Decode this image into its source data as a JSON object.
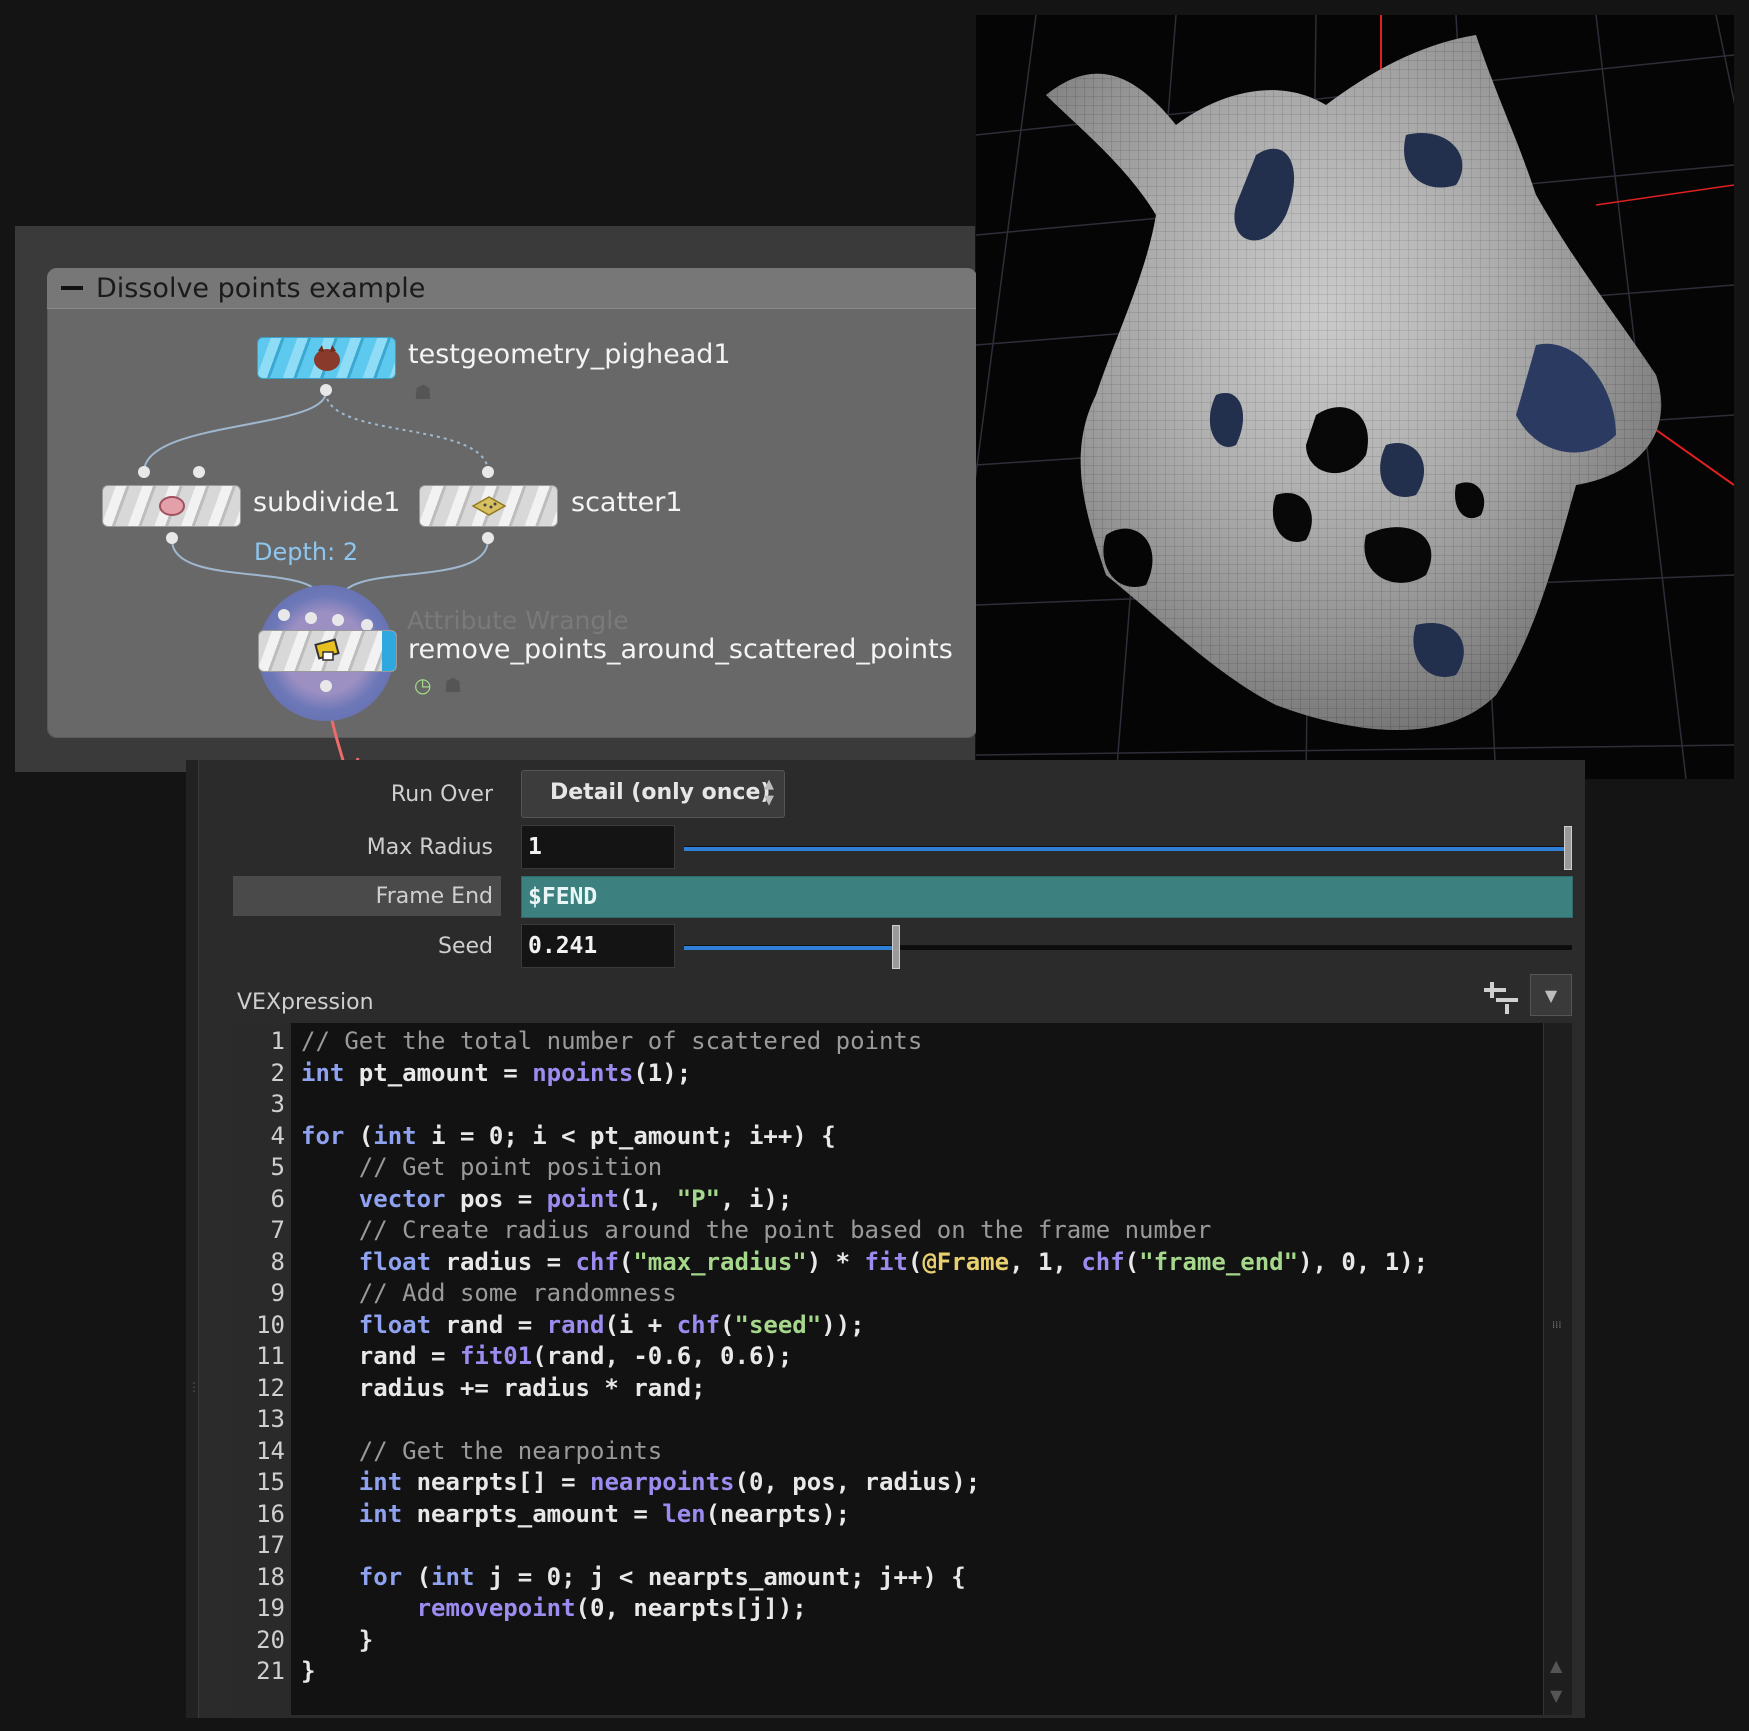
{
  "network": {
    "box_title": "Dissolve points example",
    "nodes": [
      {
        "name": "testgeometry_pighead1"
      },
      {
        "name": "subdivide1",
        "badge": "Depth: 2"
      },
      {
        "name": "scatter1"
      },
      {
        "name": "remove_points_around_scattered_points",
        "type": "Attribute Wrangle"
      }
    ]
  },
  "params": {
    "run_over": {
      "label": "Run Over",
      "value": "Detail (only once)"
    },
    "max_radius": {
      "label": "Max Radius",
      "value": "1",
      "slider_fraction": 1.0
    },
    "frame_end": {
      "label": "Frame End",
      "value": "$FEND"
    },
    "seed": {
      "label": "Seed",
      "value": "0.241",
      "slider_fraction": 0.241
    },
    "vexpression_label": "VEXpression"
  },
  "code_lines": [
    "// Get the total number of scattered points",
    "int pt_amount = npoints(1);",
    "",
    "for (int i = 0; i < pt_amount; i++) {",
    "    // Get point position",
    "    vector pos = point(1, \"P\", i);",
    "    // Create radius around the point based on the frame number",
    "    float radius = chf(\"max_radius\") * fit(@Frame, 1, chf(\"frame_end\"), 0, 1);",
    "    // Add some randomness",
    "    float rand = rand(i + chf(\"seed\"));",
    "    rand = fit01(rand, -0.6, 0.6);",
    "    radius += radius * rand;",
    "",
    "    // Get the nearpoints",
    "    int nearpts[] = nearpoints(0, pos, radius);",
    "    int nearpts_amount = len(nearpts);",
    "",
    "    for (int j = 0; j < nearpts_amount; j++) {",
    "        removepoint(0, nearpts[j]);",
    "    }",
    "}"
  ],
  "line_numbers": [
    "1",
    "2",
    "3",
    "4",
    "5",
    "6",
    "7",
    "8",
    "9",
    "10",
    "11",
    "12",
    "13",
    "14",
    "15",
    "16",
    "17",
    "18",
    "19",
    "20",
    "21"
  ],
  "colors": {
    "keyword": "#8fa2f0",
    "function": "#9b8cf0",
    "string": "#a6d88c",
    "comment": "#9a9a9a",
    "frame_end_field": "#3d8080",
    "slider_fill": "#2f7fd6"
  }
}
